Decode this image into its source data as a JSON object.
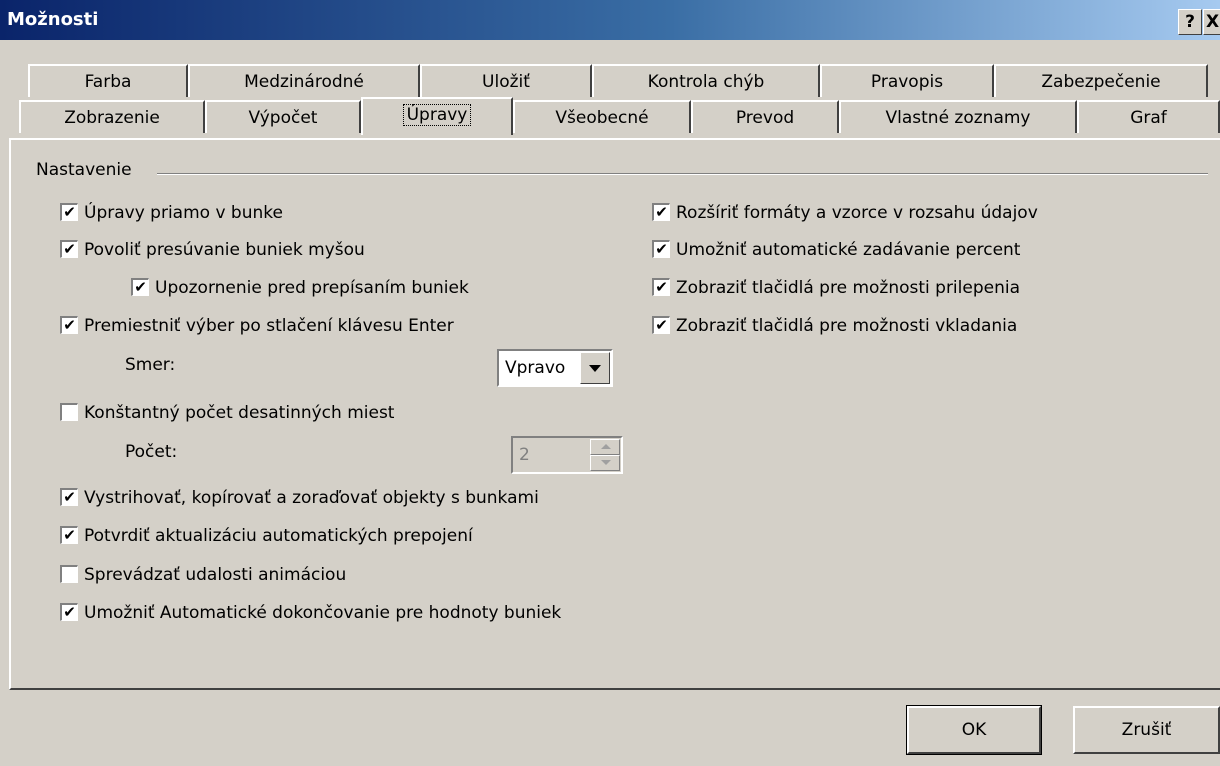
{
  "window": {
    "title": "Možnosti",
    "help_label": "?",
    "close_label": "X"
  },
  "tabs_back": [
    "Farba",
    "Medzinárodné",
    "Uložiť",
    "Kontrola chýb",
    "Pravopis",
    "Zabezpečenie"
  ],
  "tabs_front": [
    "Zobrazenie",
    "Výpočet",
    "Úpravy",
    "Všeobecné",
    "Prevod",
    "Vlastné zoznamy",
    "Graf"
  ],
  "active_tab": "Úpravy",
  "group": {
    "label": "Nastavenie"
  },
  "left_options": [
    {
      "label": "Úpravy priamo v bunke",
      "checked": true
    },
    {
      "label": "Povoliť presúvanie buniek myšou",
      "checked": true
    },
    {
      "label": "Upozornenie pred prepísaním buniek",
      "checked": true
    },
    {
      "label": "Premiestniť výber po stlačení klávesu Enter",
      "checked": true
    },
    {
      "label": "Konštantný počet desatinných miest",
      "checked": false
    },
    {
      "label": "Vystrihovať, kopírovať a zoraďovať objekty s bunkami",
      "checked": true
    },
    {
      "label": "Potvrdiť aktualizáciu automatických prepojení",
      "checked": true
    },
    {
      "label": "Sprevádzať udalosti animáciou",
      "checked": false
    },
    {
      "label": "Umožniť Automatické dokončovanie pre hodnoty buniek",
      "checked": true
    }
  ],
  "right_options": [
    {
      "label": "Rozšíriť formáty a vzorce v rozsahu údajov",
      "checked": true
    },
    {
      "label": "Umožniť automatické zadávanie percent",
      "checked": true
    },
    {
      "label": "Zobraziť tlačidlá pre možnosti prilepenia",
      "checked": true
    },
    {
      "label": "Zobraziť tlačidlá pre možnosti vkladania",
      "checked": true
    }
  ],
  "direction": {
    "label": "Smer:",
    "value": "Vpravo"
  },
  "places": {
    "label": "Počet:",
    "value": "2"
  },
  "buttons": {
    "ok": "OK",
    "cancel": "Zrušiť"
  }
}
